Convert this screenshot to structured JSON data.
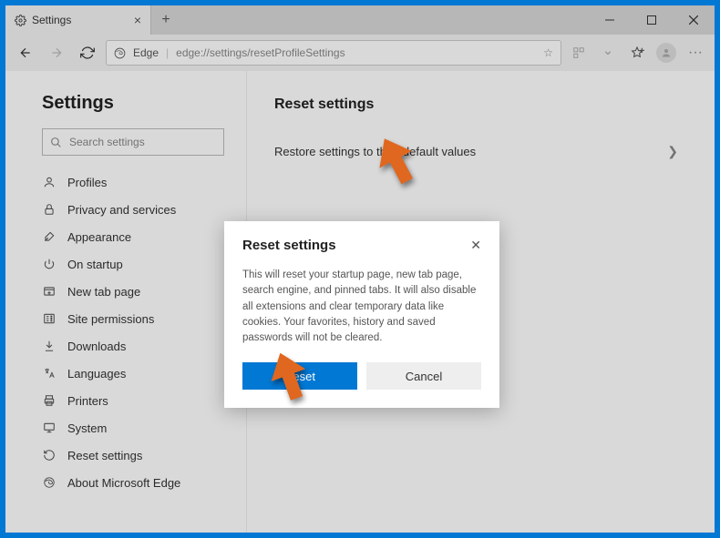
{
  "titlebar": {
    "tab_title": "Settings"
  },
  "toolbar": {
    "browser_label": "Edge",
    "url": "edge://settings/resetProfileSettings"
  },
  "sidebar": {
    "heading": "Settings",
    "search_placeholder": "Search settings",
    "items": [
      {
        "label": "Profiles",
        "icon": "person"
      },
      {
        "label": "Privacy and services",
        "icon": "lock"
      },
      {
        "label": "Appearance",
        "icon": "appearance"
      },
      {
        "label": "On startup",
        "icon": "power"
      },
      {
        "label": "New tab page",
        "icon": "newtab"
      },
      {
        "label": "Site permissions",
        "icon": "permissions"
      },
      {
        "label": "Downloads",
        "icon": "download"
      },
      {
        "label": "Languages",
        "icon": "language"
      },
      {
        "label": "Printers",
        "icon": "printer"
      },
      {
        "label": "System",
        "icon": "system"
      },
      {
        "label": "Reset settings",
        "icon": "reset"
      },
      {
        "label": "About Microsoft Edge",
        "icon": "edge"
      }
    ]
  },
  "main": {
    "heading": "Reset settings",
    "restore_label": "Restore settings to their default values"
  },
  "dialog": {
    "title": "Reset settings",
    "body": "This will reset your startup page, new tab page, search engine, and pinned tabs. It will also disable all extensions and clear temporary data like cookies. Your favorites, history and saved passwords will not be cleared.",
    "primary": "Reset",
    "secondary": "Cancel"
  }
}
